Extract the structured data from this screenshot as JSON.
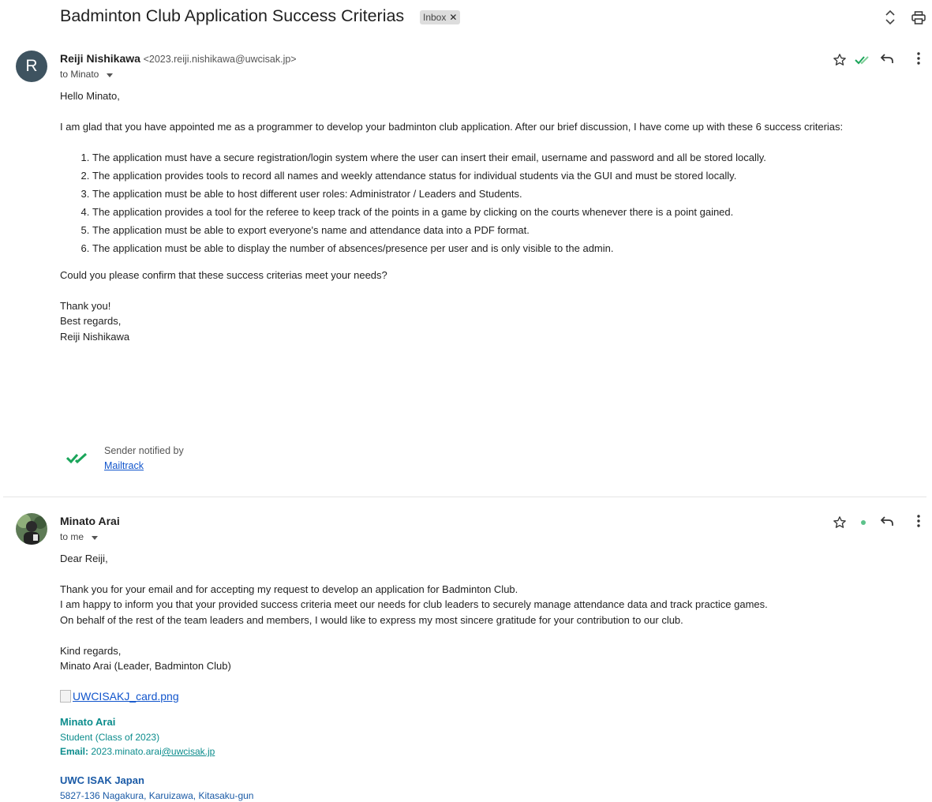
{
  "thread": {
    "subject": "Badminton Club Application Success Criterias",
    "label": "Inbox"
  },
  "icons": {
    "expand": "unfold-icon",
    "print": "print-icon",
    "star": "star-icon",
    "reply": "reply-icon",
    "more": "more-vert-icon",
    "mailtrack": "double-check-icon"
  },
  "colors": {
    "avatar_bg": "#3e5360",
    "mailtrack_green": "#1aa55a",
    "link": "#1155cc",
    "signature_teal": "#0b8c8c",
    "signature_blue": "#1a5aa6"
  },
  "message1": {
    "avatar_letter": "R",
    "sender_name": "Reiji Nishikawa",
    "sender_email": "<2023.reiji.nishikawa@uwcisak.jp>",
    "to": "to Minato",
    "greeting": "Hello Minato,",
    "intro": "I am glad that you have appointed me as a programmer to develop your badminton club application. After our brief discussion, I have come up with these 6 success criterias:",
    "criteria": [
      "The application must have a secure registration/login system where the user can insert their email, username and password and all be stored locally.",
      "The application provides tools to record all names and weekly attendance status for individual students via the GUI and must be stored locally.",
      "The application must be able to host different user roles: Administrator / Leaders and Students.",
      "The application provides a tool for the referee to keep track of the points in a game by clicking on the courts whenever there is a point gained.",
      "The application must be able to export everyone's name and attendance data into a PDF format.",
      "The application must be able to display the number of absences/presence per user and is only visible to the admin."
    ],
    "question": "Could you please confirm that these success criterias meet your needs?",
    "thanks": "Thank you!",
    "closing": "Best regards,",
    "signature": "Reiji Nishikawa",
    "mailtrack_note": "Sender notified by",
    "mailtrack_link": "Mailtrack"
  },
  "message2": {
    "sender_name": "Minato Arai",
    "to": "to me",
    "greeting": "Dear Reiji,",
    "lines": [
      "Thank you for your email and for accepting my request to develop an application for Badminton Club.",
      "I am happy to inform you that your provided success criteria meet our needs for club leaders to securely manage attendance data and track practice games.",
      "On behalf of the rest of the team leaders and members, I would like to express my most sincere gratitude for your contribution to our club."
    ],
    "closing": "Kind regards,",
    "signature": "Minato Arai (Leader, Badminton Club)",
    "card_image_alt": "UWCISAKJ_card.png",
    "sig_name": "Minato Arai",
    "sig_role": "Student (Class of 2023)",
    "sig_email_label": "Email:",
    "sig_email_user": "2023.minato.arai",
    "sig_email_domain": "@uwcisak.jp",
    "org_name": "UWC ISAK Japan",
    "org_address": "5827-136 Nagakura, Karuizawa, Kitasaku-gun"
  }
}
